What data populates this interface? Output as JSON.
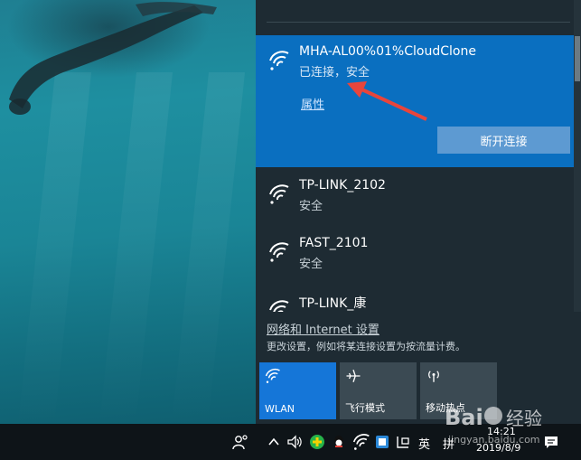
{
  "networks": {
    "connected": {
      "ssid": "MHA-AL00%01%CloudClone",
      "status": "已连接，安全",
      "properties": "属性",
      "disconnect": "断开连接"
    },
    "available": [
      {
        "ssid": "TP-LINK_2102",
        "status": "安全"
      },
      {
        "ssid": "FAST_2101",
        "status": "安全"
      },
      {
        "ssid": "TP-LINK_康",
        "status": ""
      }
    ]
  },
  "settings": {
    "link": "网络和 Internet 设置",
    "description": "更改设置，例如将某连接设置为按流量计费。"
  },
  "tiles": [
    {
      "label": "WLAN",
      "icon": "wifi-icon",
      "active": true
    },
    {
      "label": "飞行模式",
      "icon": "airplane-icon",
      "active": false
    },
    {
      "label": "移动热点",
      "icon": "hotspot-icon",
      "active": false
    }
  ],
  "taskbar": {
    "input_lang": "英",
    "ime_label": "拼",
    "clock_time": "14:21",
    "clock_date": "2019/8/9"
  },
  "watermark": {
    "text": "Bai 经验",
    "subtext": "jingyan.baidu.com"
  },
  "colors": {
    "accent": "#0a6fc0",
    "flyout_bg": "#1e2b33",
    "taskbar_bg": "#0e1418",
    "arrow": "#e8453c"
  }
}
